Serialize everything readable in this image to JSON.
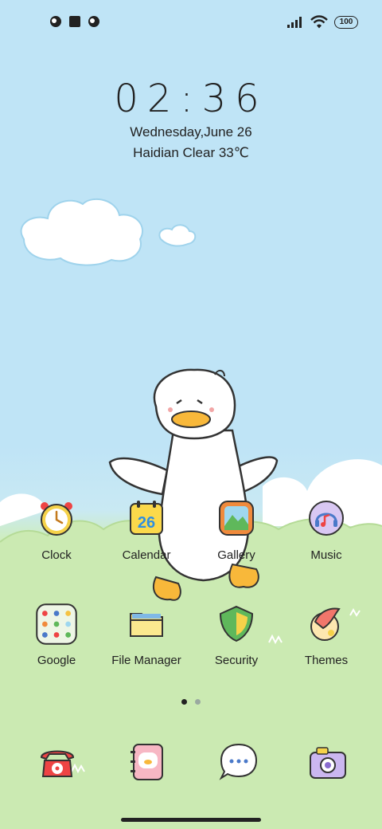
{
  "status_bar": {
    "left_icons": [
      "notification-icon",
      "square-notification-icon",
      "notification-icon"
    ],
    "battery_level": "100",
    "signal": "cellular-signal-icon",
    "wifi": "wifi-icon"
  },
  "lockclock": {
    "time": "02:36",
    "date": "Wednesday,June 26",
    "weather": "Haidian Clear 33℃"
  },
  "apps": [
    {
      "label": "Clock",
      "icon": "alarm-clock-icon"
    },
    {
      "label": "Calendar",
      "icon": "calendar-icon"
    },
    {
      "label": "Gallery",
      "icon": "gallery-icon"
    },
    {
      "label": "Music",
      "icon": "music-icon"
    },
    {
      "label": "Google",
      "icon": "google-folder-icon"
    },
    {
      "label": "File Manager",
      "icon": "folder-icon"
    },
    {
      "label": "Security",
      "icon": "shield-icon"
    },
    {
      "label": "Themes",
      "icon": "themes-icon"
    }
  ],
  "page_indicator": {
    "pages": 2,
    "current": 1
  },
  "dock": [
    {
      "icon": "phone-icon"
    },
    {
      "icon": "contacts-icon"
    },
    {
      "icon": "messages-icon"
    },
    {
      "icon": "camera-icon"
    }
  ],
  "colors": {
    "sky": "#bfe4f6",
    "grass": "#cbeab2",
    "text": "#222222"
  }
}
